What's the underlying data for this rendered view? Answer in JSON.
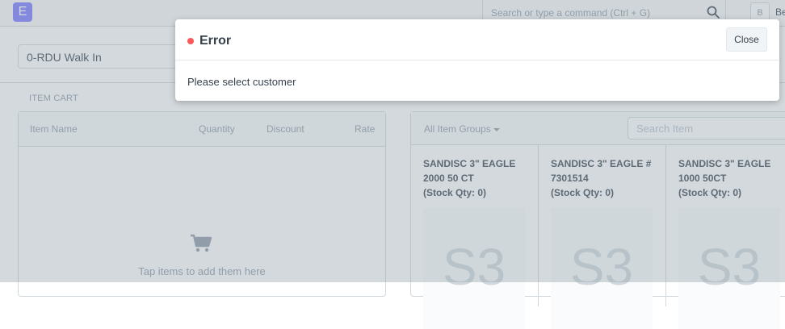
{
  "navbar": {
    "logo_letter": "E",
    "search_placeholder": "Search or type a command (Ctrl + G)",
    "avatar_initial": "B",
    "user_name": "Be"
  },
  "pos": {
    "customer": "0-RDU Walk In",
    "cart_section_label": "ITEM CART",
    "cart_columns": [
      "Item Name",
      "Quantity",
      "Discount",
      "Rate"
    ],
    "cart_empty_text": "Tap items to add them here",
    "item_group_filter": "All Item Groups",
    "item_search_placeholder": "Search Item",
    "items": [
      {
        "name": "SANDISC 3\" EAGLE 2000 50 CT",
        "stock": "(Stock Qty: 0)",
        "abbr": "S3"
      },
      {
        "name": "SANDISC 3\" EAGLE # 7301514",
        "stock": "(Stock Qty: 0)",
        "abbr": "S3"
      },
      {
        "name": "SANDISC 3\" EAGLE 1000 50CT",
        "stock": "(Stock Qty: 0)",
        "abbr": "S3"
      }
    ]
  },
  "modal": {
    "title": "Error",
    "close_label": "Close",
    "message": "Please select customer"
  },
  "colors": {
    "indicator_red": "#ff5858",
    "logo_purple": "#7575ff",
    "overlay": "#97a5af"
  },
  "icons": {
    "search": "search-icon",
    "cart": "shopping-cart-icon",
    "caret": "caret-down-icon"
  }
}
